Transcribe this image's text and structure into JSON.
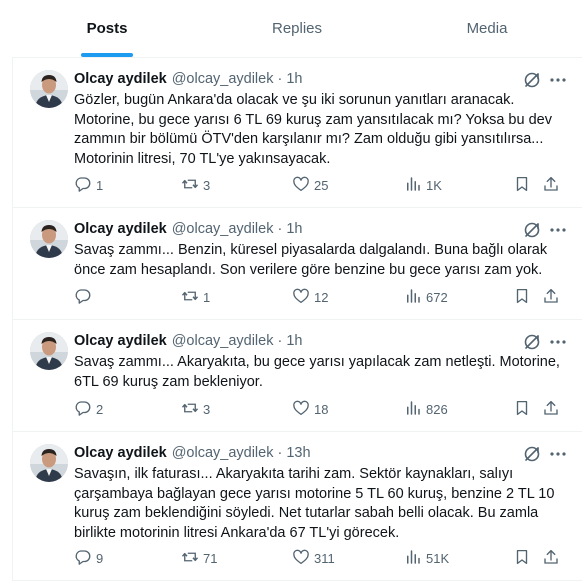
{
  "tabs": [
    {
      "label": "Posts",
      "active": true
    },
    {
      "label": "Replies",
      "active": false
    },
    {
      "label": "Media",
      "active": false
    }
  ],
  "colors": {
    "accent": "#1d9bf0",
    "text": "#0f1419",
    "muted": "#536471",
    "border": "#eff3f4"
  },
  "posts": [
    {
      "name": "Olcay aydilek",
      "handle": "@olcay_aydilek",
      "sep": "·",
      "time": "1h",
      "text": "Gözler, bugün Ankara'da olacak ve şu iki sorunun yanıtları aranacak.\nMotorine, bu gece yarısı 6 TL 69 kuruş zam yansıtılacak mı? Yoksa bu dev\nzammın bir bölümü ÖTV'den karşılanır mı? Zam olduğu gibi  yansıtılırsa...\nMotorinin litresi, 70 TL'ye yakınsayacak.",
      "replies": "1",
      "reposts": "3",
      "likes": "25",
      "views": "1K"
    },
    {
      "name": "Olcay aydilek",
      "handle": "@olcay_aydilek",
      "sep": "·",
      "time": "1h",
      "text": "Savaş zammı... Benzin, küresel piyasalarda dalgalandı. Buna bağlı olarak\nönce zam hesaplandı. Son verilere göre benzine bu gece yarısı zam yok.",
      "replies": "",
      "reposts": "1",
      "likes": "12",
      "views": "672"
    },
    {
      "name": "Olcay aydilek",
      "handle": "@olcay_aydilek",
      "sep": "·",
      "time": "1h",
      "text": "Savaş zammı... Akaryakıta, bu gece yarısı yapılacak zam netleşti. Motorine,\n6TL 69 kuruş zam bekleniyor.",
      "replies": "2",
      "reposts": "3",
      "likes": "18",
      "views": "826"
    },
    {
      "name": "Olcay aydilek",
      "handle": "@olcay_aydilek",
      "sep": "·",
      "time": "13h",
      "text": "Savaşın, ilk faturası... Akaryakıta tarihi zam. Sektör kaynakları, salıyı\nçarşambaya bağlayan gece yarısı motorine 5 TL 60 kuruş, benzine 2 TL 10\nkuruş zam beklendiğini söyledi. Net tutarlar sabah belli olacak. Bu zamla\nbirlikte motorinin litresi Ankara'da 67 TL'yi görecek.",
      "replies": "9",
      "reposts": "71",
      "likes": "311",
      "views": "51K"
    }
  ]
}
